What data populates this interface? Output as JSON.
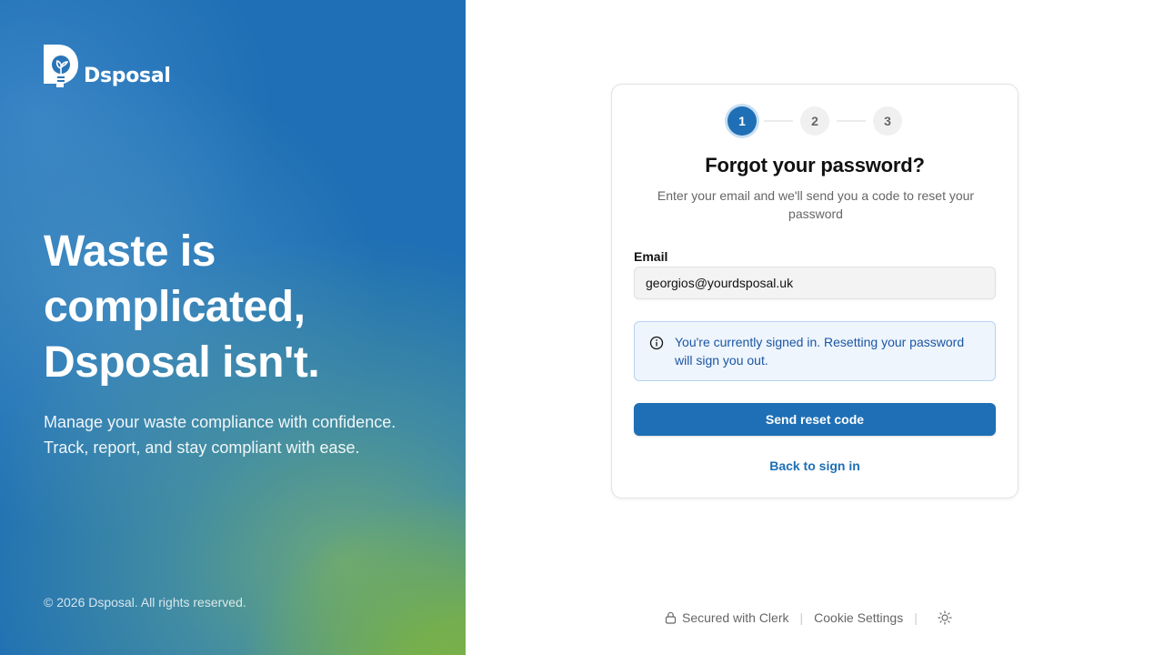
{
  "brand": {
    "name": "Dsposal"
  },
  "hero": {
    "headline_lines": [
      "Waste is",
      "complicated,",
      "Dsposal isn't."
    ],
    "subtext_lines": [
      "Manage your waste compliance with confidence.",
      "Track, report, and stay compliant with ease."
    ],
    "copyright": "© 2026 Dsposal. All rights reserved."
  },
  "stepper": {
    "steps": [
      "1",
      "2",
      "3"
    ],
    "active_step": 1
  },
  "form": {
    "title": "Forgot your password?",
    "description": "Enter your email and we'll send you a code to reset your password",
    "email_label": "Email",
    "email_value": "georgios@yourdsposal.uk",
    "alert_text": "You're currently signed in. Resetting your password will sign you out.",
    "submit_label": "Send reset code",
    "back_link": "Back to sign in"
  },
  "footer": {
    "secured": "Secured with Clerk",
    "separator": "|",
    "cookie": "Cookie Settings",
    "theme_icon": "sun-icon"
  },
  "colors": {
    "primary": "#1e6fb5",
    "alert_bg": "#eef5fd",
    "alert_text": "#1b56a3"
  }
}
